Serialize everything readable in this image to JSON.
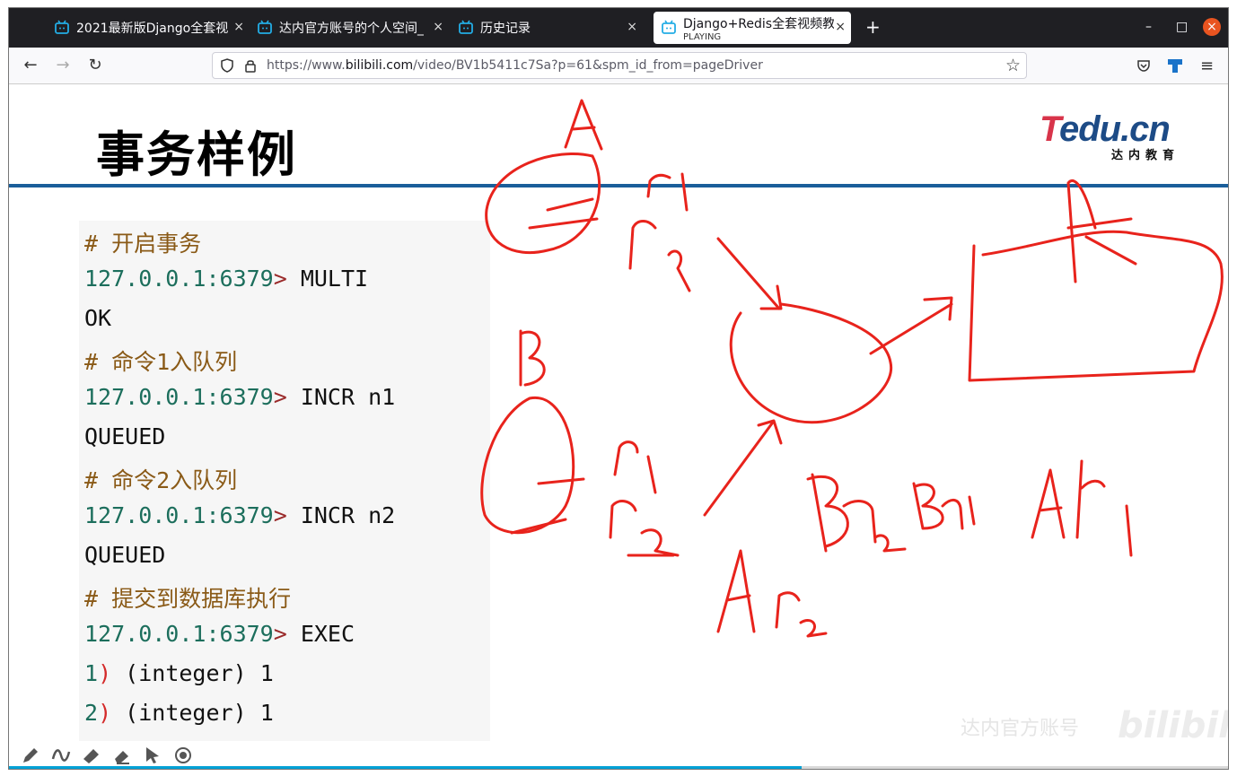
{
  "tabs": [
    {
      "label": "2021最新版Django全套视",
      "close": "×"
    },
    {
      "label": "达内官方账号的个人空间_",
      "close": "×"
    },
    {
      "label": "历史记录",
      "close": "×"
    },
    {
      "label": "Django+Redis全套视频教",
      "sub": "PLAYING",
      "close": "×",
      "active": true
    }
  ],
  "tabs_new": "+",
  "window_controls": {
    "minimize": "–",
    "maximize": "□",
    "close": "×"
  },
  "nav": {
    "back": "←",
    "forward": "→",
    "reload": "↻",
    "url_prefix": "https://www.",
    "url_domain": "bilibili.com",
    "url_rest": "/video/BV1b5411c7Sa?p=61&spm_id_from=pageDriver",
    "star": "☆"
  },
  "slide": {
    "title": "事务样例",
    "logo_main_a": "T",
    "logo_main_b": "edu.cn",
    "logo_sub": "达内教育",
    "code": [
      {
        "kind": "comment",
        "text": "#  开启事务"
      },
      {
        "kind": "cmd",
        "prompt": "127.0.0.1:6379",
        "gt": ">",
        "cmd": " MULTI"
      },
      {
        "kind": "out",
        "text": "OK"
      },
      {
        "kind": "comment",
        "text": "#  命令1入队列"
      },
      {
        "kind": "cmd",
        "prompt": "127.0.0.1:6379",
        "gt": ">",
        "cmd": " INCR n1"
      },
      {
        "kind": "out",
        "text": "QUEUED"
      },
      {
        "kind": "comment",
        "text": "#  命令2入队列"
      },
      {
        "kind": "cmd",
        "prompt": "127.0.0.1:6379",
        "gt": ">",
        "cmd": " INCR n2"
      },
      {
        "kind": "out",
        "text": "QUEUED"
      },
      {
        "kind": "comment",
        "text": "#  提交到数据库执行"
      },
      {
        "kind": "cmd",
        "prompt": "127.0.0.1:6379",
        "gt": ">",
        "cmd": " EXEC"
      },
      {
        "kind": "result",
        "num": "1",
        "paren": ")",
        "rest": " (integer) 1"
      },
      {
        "kind": "result",
        "num": "2",
        "paren": ")",
        "rest": " (integer) 1"
      }
    ],
    "watermark": "达内官方账号",
    "watermark_brand": "bilibili"
  },
  "annotation_tools": [
    "pen-icon",
    "curve-icon",
    "highlighter-icon",
    "eraser-icon",
    "pointer-icon",
    "record-icon"
  ],
  "annotation_color": "#e8231c",
  "video_progress": 0.65
}
